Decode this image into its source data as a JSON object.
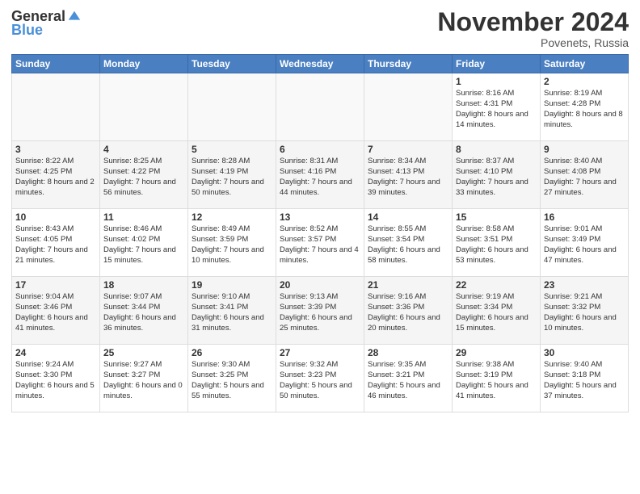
{
  "header": {
    "logo_general": "General",
    "logo_blue": "Blue",
    "month_title": "November 2024",
    "location": "Povenets, Russia"
  },
  "days_of_week": [
    "Sunday",
    "Monday",
    "Tuesday",
    "Wednesday",
    "Thursday",
    "Friday",
    "Saturday"
  ],
  "weeks": [
    [
      {
        "day": "",
        "info": ""
      },
      {
        "day": "",
        "info": ""
      },
      {
        "day": "",
        "info": ""
      },
      {
        "day": "",
        "info": ""
      },
      {
        "day": "",
        "info": ""
      },
      {
        "day": "1",
        "info": "Sunrise: 8:16 AM\nSunset: 4:31 PM\nDaylight: 8 hours\nand 14 minutes."
      },
      {
        "day": "2",
        "info": "Sunrise: 8:19 AM\nSunset: 4:28 PM\nDaylight: 8 hours\nand 8 minutes."
      }
    ],
    [
      {
        "day": "3",
        "info": "Sunrise: 8:22 AM\nSunset: 4:25 PM\nDaylight: 8 hours\nand 2 minutes."
      },
      {
        "day": "4",
        "info": "Sunrise: 8:25 AM\nSunset: 4:22 PM\nDaylight: 7 hours\nand 56 minutes."
      },
      {
        "day": "5",
        "info": "Sunrise: 8:28 AM\nSunset: 4:19 PM\nDaylight: 7 hours\nand 50 minutes."
      },
      {
        "day": "6",
        "info": "Sunrise: 8:31 AM\nSunset: 4:16 PM\nDaylight: 7 hours\nand 44 minutes."
      },
      {
        "day": "7",
        "info": "Sunrise: 8:34 AM\nSunset: 4:13 PM\nDaylight: 7 hours\nand 39 minutes."
      },
      {
        "day": "8",
        "info": "Sunrise: 8:37 AM\nSunset: 4:10 PM\nDaylight: 7 hours\nand 33 minutes."
      },
      {
        "day": "9",
        "info": "Sunrise: 8:40 AM\nSunset: 4:08 PM\nDaylight: 7 hours\nand 27 minutes."
      }
    ],
    [
      {
        "day": "10",
        "info": "Sunrise: 8:43 AM\nSunset: 4:05 PM\nDaylight: 7 hours\nand 21 minutes."
      },
      {
        "day": "11",
        "info": "Sunrise: 8:46 AM\nSunset: 4:02 PM\nDaylight: 7 hours\nand 15 minutes."
      },
      {
        "day": "12",
        "info": "Sunrise: 8:49 AM\nSunset: 3:59 PM\nDaylight: 7 hours\nand 10 minutes."
      },
      {
        "day": "13",
        "info": "Sunrise: 8:52 AM\nSunset: 3:57 PM\nDaylight: 7 hours\nand 4 minutes."
      },
      {
        "day": "14",
        "info": "Sunrise: 8:55 AM\nSunset: 3:54 PM\nDaylight: 6 hours\nand 58 minutes."
      },
      {
        "day": "15",
        "info": "Sunrise: 8:58 AM\nSunset: 3:51 PM\nDaylight: 6 hours\nand 53 minutes."
      },
      {
        "day": "16",
        "info": "Sunrise: 9:01 AM\nSunset: 3:49 PM\nDaylight: 6 hours\nand 47 minutes."
      }
    ],
    [
      {
        "day": "17",
        "info": "Sunrise: 9:04 AM\nSunset: 3:46 PM\nDaylight: 6 hours\nand 41 minutes."
      },
      {
        "day": "18",
        "info": "Sunrise: 9:07 AM\nSunset: 3:44 PM\nDaylight: 6 hours\nand 36 minutes."
      },
      {
        "day": "19",
        "info": "Sunrise: 9:10 AM\nSunset: 3:41 PM\nDaylight: 6 hours\nand 31 minutes."
      },
      {
        "day": "20",
        "info": "Sunrise: 9:13 AM\nSunset: 3:39 PM\nDaylight: 6 hours\nand 25 minutes."
      },
      {
        "day": "21",
        "info": "Sunrise: 9:16 AM\nSunset: 3:36 PM\nDaylight: 6 hours\nand 20 minutes."
      },
      {
        "day": "22",
        "info": "Sunrise: 9:19 AM\nSunset: 3:34 PM\nDaylight: 6 hours\nand 15 minutes."
      },
      {
        "day": "23",
        "info": "Sunrise: 9:21 AM\nSunset: 3:32 PM\nDaylight: 6 hours\nand 10 minutes."
      }
    ],
    [
      {
        "day": "24",
        "info": "Sunrise: 9:24 AM\nSunset: 3:30 PM\nDaylight: 6 hours\nand 5 minutes."
      },
      {
        "day": "25",
        "info": "Sunrise: 9:27 AM\nSunset: 3:27 PM\nDaylight: 6 hours\nand 0 minutes."
      },
      {
        "day": "26",
        "info": "Sunrise: 9:30 AM\nSunset: 3:25 PM\nDaylight: 5 hours\nand 55 minutes."
      },
      {
        "day": "27",
        "info": "Sunrise: 9:32 AM\nSunset: 3:23 PM\nDaylight: 5 hours\nand 50 minutes."
      },
      {
        "day": "28",
        "info": "Sunrise: 9:35 AM\nSunset: 3:21 PM\nDaylight: 5 hours\nand 46 minutes."
      },
      {
        "day": "29",
        "info": "Sunrise: 9:38 AM\nSunset: 3:19 PM\nDaylight: 5 hours\nand 41 minutes."
      },
      {
        "day": "30",
        "info": "Sunrise: 9:40 AM\nSunset: 3:18 PM\nDaylight: 5 hours\nand 37 minutes."
      }
    ]
  ]
}
